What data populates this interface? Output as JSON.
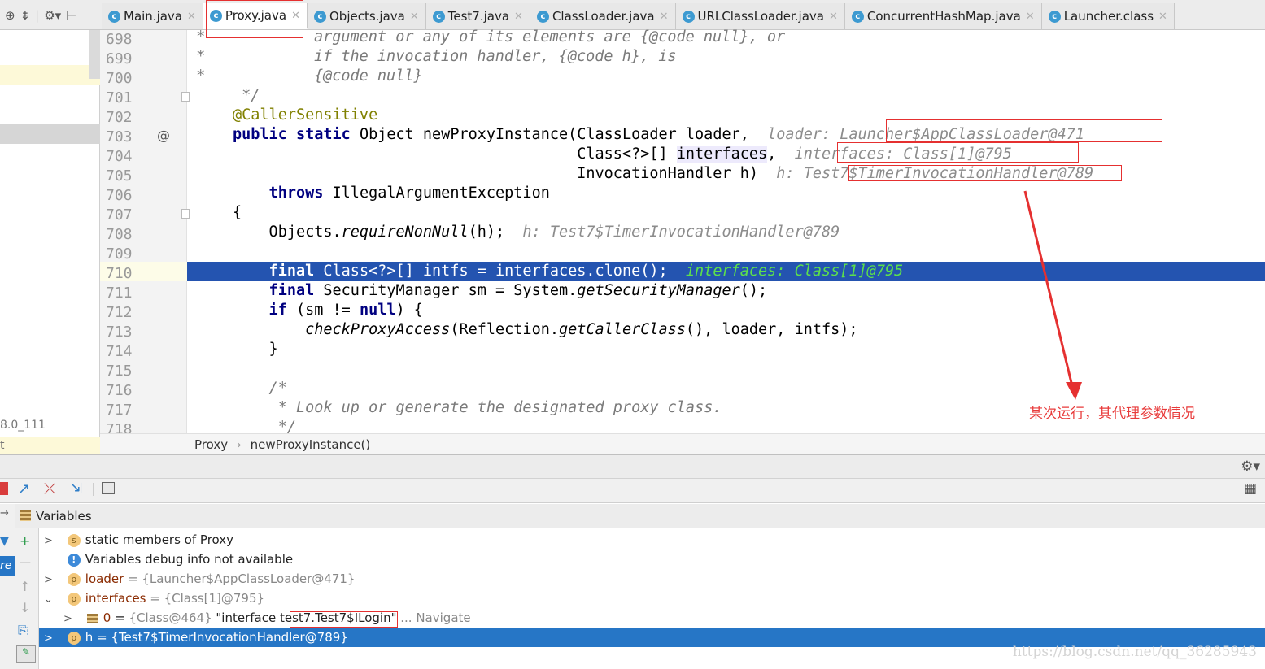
{
  "tabs": [
    {
      "label": "Main.java"
    },
    {
      "label": "Proxy.java"
    },
    {
      "label": "Objects.java"
    },
    {
      "label": "Test7.java"
    },
    {
      "label": "ClassLoader.java"
    },
    {
      "label": "URLClassLoader.java"
    },
    {
      "label": "ConcurrentHashMap.java"
    },
    {
      "label": "Launcher.class"
    }
  ],
  "gutter": {
    "lines": [
      "698",
      "699",
      "700",
      "701",
      "702",
      "703",
      "704",
      "705",
      "706",
      "707",
      "708",
      "709",
      "710",
      "711",
      "712",
      "713",
      "714",
      "715",
      "716",
      "717",
      "718"
    ],
    "marker": "@"
  },
  "left_strip": {
    "jdk_label": "8.0_111",
    "t_label": "t",
    "re_label": "re"
  },
  "code": {
    "l698_a": " *         ",
    "l698_b": "argument or any of its elements are {@code null}, or",
    "l699_a": " *         ",
    "l699_b": "if the invocation handler, {@code h}, is",
    "l700_a": " *         ",
    "l700_b": "{@code null}",
    "l701": " */",
    "l702": "@CallerSensitive",
    "l703_kw": "public static ",
    "l703_b": "Object newProxyInstance(ClassLoader loader,  ",
    "l703_hint": "loader: Launcher$AppClassLoader@471",
    "l704_a": "                                      Class<?>[] ",
    "l704_b": "interfaces",
    ",l704_c": "",
    "l704_comma": ",  ",
    "l704_hint": "interfaces: Class[1]@795",
    "l705_a": "                                      InvocationHandler h)  ",
    "l705_hint": "h: Test7$TimerInvocationHandler@789",
    "l706_kw": "    throws ",
    "l706_b": "IllegalArgumentException",
    "l707": "{",
    "l708_a": "    Objects.",
    "l708_m": "requireNonNull",
    "l708_b": "(h);  ",
    "l708_hint": "h: Test7$TimerInvocationHandler@789",
    "l710_kw": "    final ",
    "l710_b": "Class<?>[] intfs = interfaces.clone();  ",
    "l710_hint": "interfaces: Class[1]@795",
    "l711_kw": "    final ",
    "l711_b": "SecurityManager sm = System.",
    "l711_m": "getSecurityManager",
    "l711_c": "();",
    "l712_kw": "    if ",
    "l712_b": "(sm != ",
    "l712_kw2": "null",
    ",l712_c": "",
    "l712_end": ") {",
    "l713_a": "        ",
    "l713_m": "checkProxyAccess",
    "l713_b": "(Reflection.",
    "l713_m2": "getCallerClass",
    "l713_c": "(), loader, intfs);",
    "l714": "    }",
    "l716": "    /*",
    "l717": "     * Look up or generate the designated proxy class.",
    "l718": "     */"
  },
  "breadcrumb": {
    "cls": "Proxy",
    "sep": "›",
    "method": "newProxyInstance()"
  },
  "variables": {
    "header": "Variables",
    "rows": [
      {
        "name": "static members of Proxy"
      },
      {
        "name": "Variables debug info not available"
      },
      {
        "name": "loader",
        "value": " = {Launcher$AppClassLoader@471}"
      },
      {
        "name": "interfaces",
        "value": " = {Class[1]@795}"
      },
      {
        "name": "0",
        "value": " = ",
        "gray": "{Class@464} ",
        "str": "\"interface test7.Test7$ILogin\"",
        "more": " ... Navigate"
      },
      {
        "name": "h",
        "value": " = {Test7$TimerInvocationHandler@789}"
      }
    ]
  },
  "annotation": "某次运行，其代理参数情况",
  "watermark": "https://blog.csdn.net/qq_36285943",
  "colors": {
    "highlight": "#2454b0",
    "selection": "#2676c6",
    "annotation": "#e83a3a"
  }
}
